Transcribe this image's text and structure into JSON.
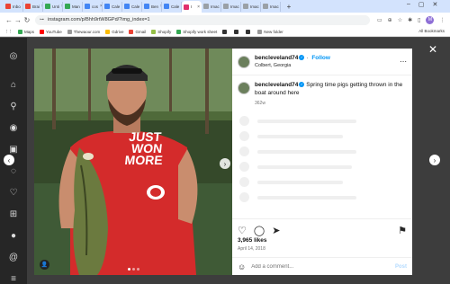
{
  "browser": {
    "tabs": [
      {
        "label": "Inbo",
        "color": "#ea4335"
      },
      {
        "label": "Brai",
        "color": "#ea4335"
      },
      {
        "label": "Unti",
        "color": "#34a853"
      },
      {
        "label": "Man",
        "color": "#34a853"
      },
      {
        "label": "cos",
        "color": "#4285f4"
      },
      {
        "label": "Cale",
        "color": "#4285f4"
      },
      {
        "label": "Cale",
        "color": "#4285f4"
      },
      {
        "label": "Ben",
        "color": "#4285f4"
      },
      {
        "label": "Cale",
        "color": "#4285f4"
      },
      {
        "label": "I",
        "color": "#e1306c",
        "active": true
      },
      {
        "label": "Imac",
        "color": "#9aa0a6"
      },
      {
        "label": "Imac",
        "color": "#9aa0a6"
      },
      {
        "label": "Imac",
        "color": "#9aa0a6"
      },
      {
        "label": "Imac",
        "color": "#9aa0a6"
      }
    ],
    "url": "instagram.com/p/Bhh9rtW8GPd/?img_index=1",
    "bookmarks": [
      {
        "label": "Maps",
        "color": "#34a853"
      },
      {
        "label": "YouTube",
        "color": "#ff0000"
      },
      {
        "label": "Thewaour.com",
        "color": "#999999"
      },
      {
        "label": "Gdrive",
        "color": "#fbbc04"
      },
      {
        "label": "Gmail",
        "color": "#ea4335"
      },
      {
        "label": "Shopify",
        "color": "#95bf47"
      },
      {
        "label": "Shopify work sheet",
        "color": "#34a853"
      },
      {
        "label": "",
        "color": "#333333"
      },
      {
        "label": "",
        "color": "#333333"
      },
      {
        "label": "",
        "color": "#333333"
      },
      {
        "label": "New folder",
        "color": "#999999"
      }
    ],
    "all_bookmarks": "All Bookmarks",
    "profile_initial": "M"
  },
  "post": {
    "username": "bencleveland74",
    "follow_label": "Follow",
    "location": "Colbert, Georgia",
    "caption_text": "Spring time pigs getting thrown in the boat around here",
    "caption_age": "362w",
    "likes": "3,965 likes",
    "date": "April 14, 2018",
    "comment_placeholder": "Add a comment...",
    "post_label": "Post",
    "shirt_lines": [
      "JUST",
      "WON",
      "MORE"
    ]
  },
  "colors": {
    "accent": "#0095f6",
    "modal_backdrop": "#3d3d3d",
    "shirt": "#d42b2b"
  }
}
